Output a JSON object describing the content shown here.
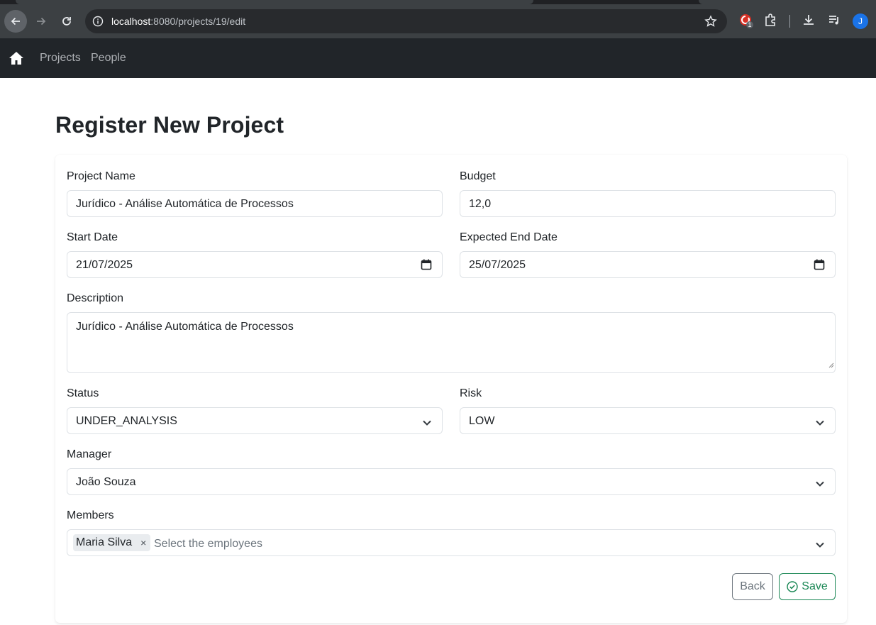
{
  "browser": {
    "url_host": "localhost",
    "url_rest": ":8080/projects/19/edit",
    "avatar_letter": "J",
    "extension_badge": "1"
  },
  "navbar": {
    "links": [
      "Projects",
      "People"
    ]
  },
  "page": {
    "title": "Register New Project"
  },
  "form": {
    "project_name": {
      "label": "Project Name",
      "value": "Jurídico - Análise Automática de Processos"
    },
    "budget": {
      "label": "Budget",
      "value": "12,0"
    },
    "start_date": {
      "label": "Start Date",
      "value": "21/07/2025"
    },
    "end_date": {
      "label": "Expected End Date",
      "value": "25/07/2025"
    },
    "description": {
      "label": "Description",
      "value": "Jurídico - Análise Automática de Processos"
    },
    "status": {
      "label": "Status",
      "value": "UNDER_ANALYSIS"
    },
    "risk": {
      "label": "Risk",
      "value": "LOW"
    },
    "manager": {
      "label": "Manager",
      "value": "João Souza"
    },
    "members": {
      "label": "Members",
      "selected": [
        "Maria Silva"
      ],
      "remove_symbol": "×",
      "placeholder": "Select the employees"
    },
    "buttons": {
      "back": "Back",
      "save": "Save"
    }
  },
  "colors": {
    "navbar_bg": "#212529",
    "save_green": "#198754",
    "back_gray": "#6c757d"
  }
}
